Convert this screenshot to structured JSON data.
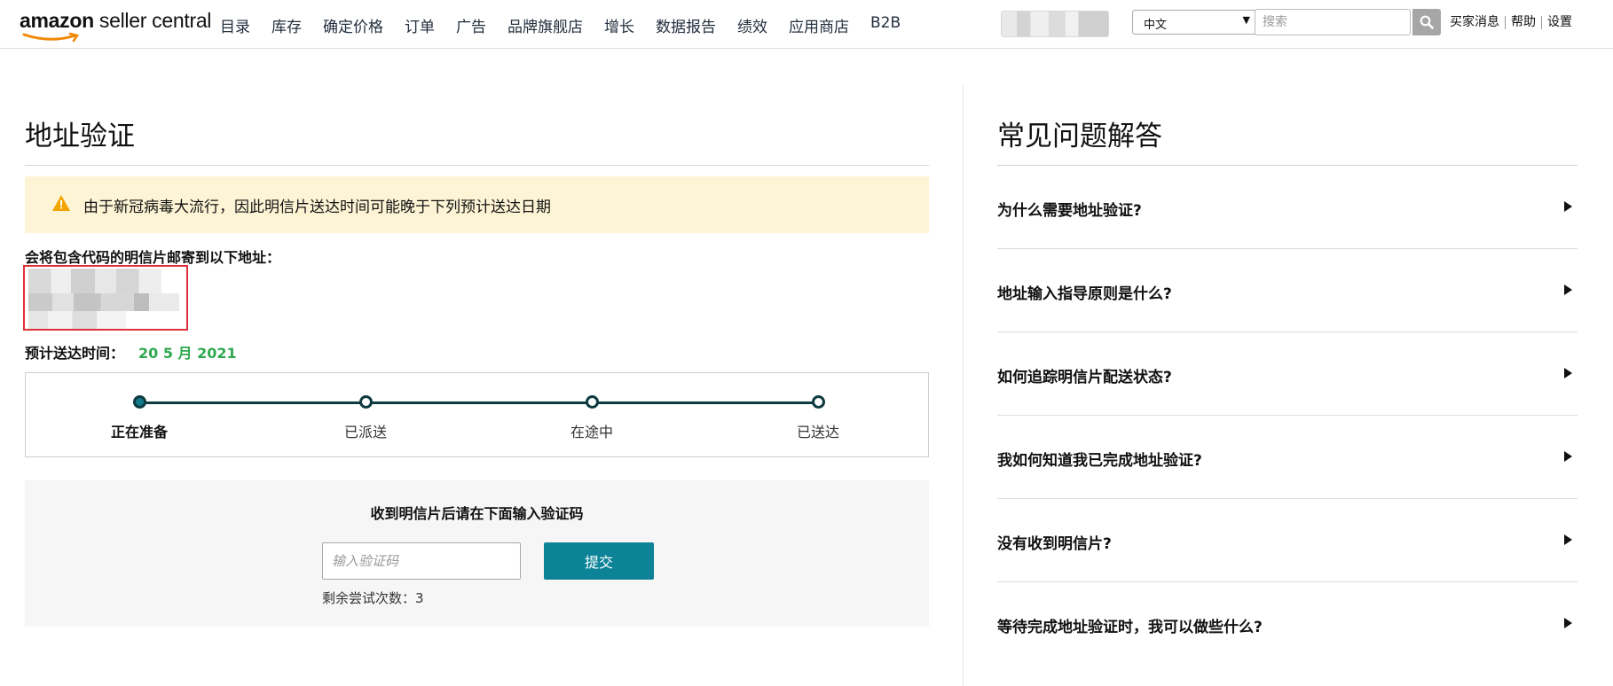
{
  "header": {
    "logo": {
      "brand": "amazon",
      "product": " seller central",
      "icon": "amazon-smile-logo"
    },
    "nav": [
      "目录",
      "库存",
      "确定价格",
      "订单",
      "广告",
      "品牌旗舰店",
      "增长",
      "数据报告",
      "绩效",
      "应用商店",
      "B2B"
    ],
    "language": {
      "selected": "中文",
      "icon": "caret-down-icon"
    },
    "search": {
      "placeholder": "搜索",
      "icon": "search-icon"
    },
    "links": [
      "买家消息",
      "帮助",
      "设置"
    ]
  },
  "main": {
    "title": "地址验证",
    "alert": {
      "icon": "warning-triangle-icon",
      "text": "由于新冠病毒大流行，因此明信片送达时间可能晚于下列预计送达日期"
    },
    "mail_label": "会将包含代码的明信片邮寄到以下地址：",
    "eta": {
      "label": "预计送达时间：",
      "value": "20 5 月 2021"
    },
    "tracker": {
      "steps": [
        "正在准备",
        "已派送",
        "在途中",
        "已送达"
      ],
      "active_index": 0
    },
    "verify": {
      "prompt": "收到明信片后请在下面输入验证码",
      "input_placeholder": "输入验证码",
      "submit_label": "提交",
      "attempts_text": "剩余尝试次数：3"
    }
  },
  "faq": {
    "title": "常见问题解答",
    "items": [
      "为什么需要地址验证?",
      "地址输入指导原则是什么?",
      "如何追踪明信片配送状态?",
      "我如何知道我已完成地址验证?",
      "没有收到明信片?",
      "等待完成地址验证时，我可以做些什么?"
    ],
    "item_icon": "triangle-right-icon"
  },
  "colors": {
    "accent_button": "#0d8397",
    "eta_green": "#2fa84f",
    "alert_bg": "#fdf4d5",
    "highlight_red": "#e0313b",
    "tracker_line": "#0d3b3f"
  }
}
